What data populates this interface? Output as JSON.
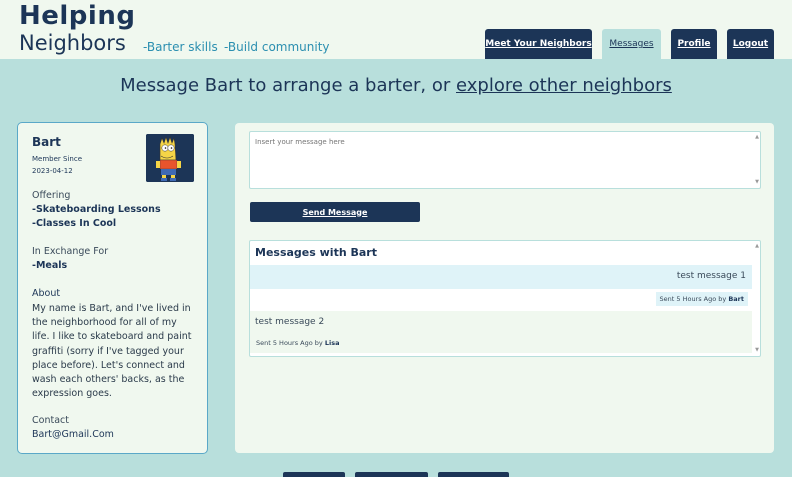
{
  "header": {
    "logo_line1": "Helping",
    "logo_line2": "Neighbors",
    "tagline1": "-Barter skills",
    "tagline2": "-Build community"
  },
  "nav": {
    "meet": "Meet Your Neighbors",
    "messages": "Messages",
    "profile": "Profile",
    "logout": "Logout"
  },
  "headline": {
    "prefix": "Message Bart to arrange a barter, or ",
    "link": "explore other neighbors"
  },
  "profile": {
    "name": "Bart",
    "member_since_label": "Member Since",
    "member_since": "2023-04-12",
    "offering_label": "Offering",
    "offerings": [
      "-Skateboarding Lessons",
      "-Classes In Cool"
    ],
    "exchange_label": "In Exchange For",
    "exchange": [
      "-Meals"
    ],
    "about_label": "About",
    "about": "My name is Bart, and I've lived in the neighborhood for all of my life. I like to skateboard and paint graffiti (sorry if I've tagged your place before). Let's connect and wash each others' backs, as the expression goes.",
    "contact_label": "Contact",
    "contact": "Bart@Gmail.Com"
  },
  "compose": {
    "placeholder": "Insert your message here",
    "send_label": "Send Message"
  },
  "thread": {
    "title": "Messages with Bart",
    "messages": [
      {
        "text": "test message 1",
        "meta": "Sent 5 Hours Ago by ",
        "author": "Bart"
      },
      {
        "text": "test message 2",
        "meta": "Sent 5 Hours Ago by ",
        "author": "Lisa"
      }
    ]
  },
  "colors": {
    "navy": "#1c3557",
    "teal_bg": "#b8dfdc",
    "panel": "#f0f8ef",
    "accent": "#2b8fb0"
  }
}
